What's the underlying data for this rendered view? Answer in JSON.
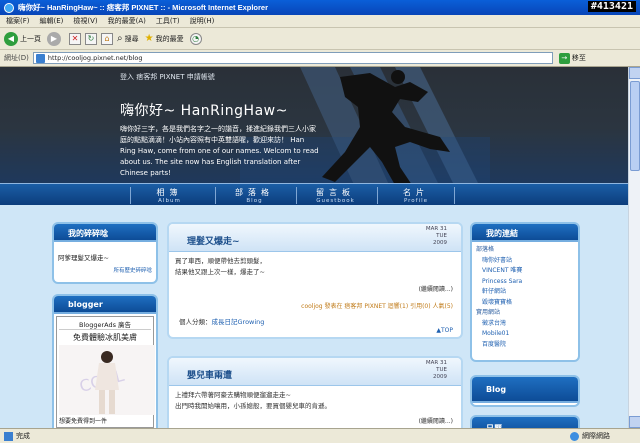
{
  "window": {
    "title": "嗨你好~ HanRingHaw~ :: 痞客邦 PIXNET :: - Microsoft Internet Explorer",
    "watermark": "#413421"
  },
  "menu": [
    "檔案(F)",
    "編輯(E)",
    "檢視(V)",
    "我的最愛(A)",
    "工具(T)",
    "說明(H)"
  ],
  "toolbar": {
    "back_label": "上一頁",
    "search_label": "搜尋",
    "favorites_label": "我的最愛"
  },
  "address": {
    "label": "網址(D)",
    "url": "http://cooljog.pixnet.net/blog",
    "go_label": "移至"
  },
  "banner": {
    "login_text": "登入  痞客邦 PIXNET 申請帳號",
    "title": "嗨你好~ HanRingHaw~",
    "intro": "嗨你好三字，各是我們名字之一的諧音，揉進紀錄我們三人小家庭的點點滴滴！小站內容照有中英雙語喔，歡迎來訪！ Han Ring Haw, come from one of our names. Welcom to read about us. The site now has English translation after Chinese parts!"
  },
  "nav": [
    {
      "zh": "相簿",
      "en": "Album"
    },
    {
      "zh": "部落格",
      "en": "Blog"
    },
    {
      "zh": "留言板",
      "en": "Guestbook"
    },
    {
      "zh": "名片",
      "en": "Profile"
    }
  ],
  "left": {
    "chatter_title": "我的碎碎唸",
    "chatter_text": "阿爹理髮又爆走~",
    "chatter_link": "所有歷史碎碎唸",
    "blogger_title": "blogger",
    "ad_title": "BloggerAds 廣告",
    "ad_subtitle": "免費體驗冰肌美膚",
    "ad_caption": "想要免費得到一件"
  },
  "posts": [
    {
      "title": "理髮又爆走~",
      "month": "MAR 31",
      "weekday": "TUE",
      "year": "2009",
      "lines": [
        "買了車西，順便帶他去剪頭髮，",
        "結果他又跟上次一樣，爆走了~"
      ],
      "more": "(繼續閱讀...)",
      "meta": "cooljog 發表在 痞客邦 PIXNET 迴響(1) 引用(0) 人氣(5)",
      "category_label": "個人分類：",
      "category": "成長日記Growing",
      "top": "▲TOP"
    },
    {
      "title": "嬰兒車兩遭",
      "month": "MAR 31",
      "weekday": "TUE",
      "year": "2009",
      "lines": [
        "上禮拜六帶著阿豪去購物順便遛遛走走~",
        "出門時我開始嚷用，小孫媳般，要買個嬰兒車的肯遜。"
      ],
      "more": "(繼續閱讀...)"
    }
  ],
  "right": {
    "links_title": "我的連結",
    "links": [
      {
        "text": "部落格",
        "group": true
      },
      {
        "text": "嗨你好書站",
        "group": false
      },
      {
        "text": "VINCENT 唯賽",
        "group": false
      },
      {
        "text": "Princess Sara",
        "group": false
      },
      {
        "text": "軒仔網站",
        "group": false
      },
      {
        "text": "毀壞寶寶格",
        "group": false
      },
      {
        "text": "實用網站",
        "group": true
      },
      {
        "text": "徵求台灣",
        "group": false
      },
      {
        "text": "Mobile01",
        "group": false
      },
      {
        "text": "百度醫院",
        "group": false
      }
    ],
    "blog_title": "Blog",
    "calendar_title": "日曆"
  },
  "status": {
    "text": "完成",
    "zone": "網際網路"
  },
  "colors": {
    "accent": "#0d4c97",
    "page_bg": "#cfe6f7"
  }
}
